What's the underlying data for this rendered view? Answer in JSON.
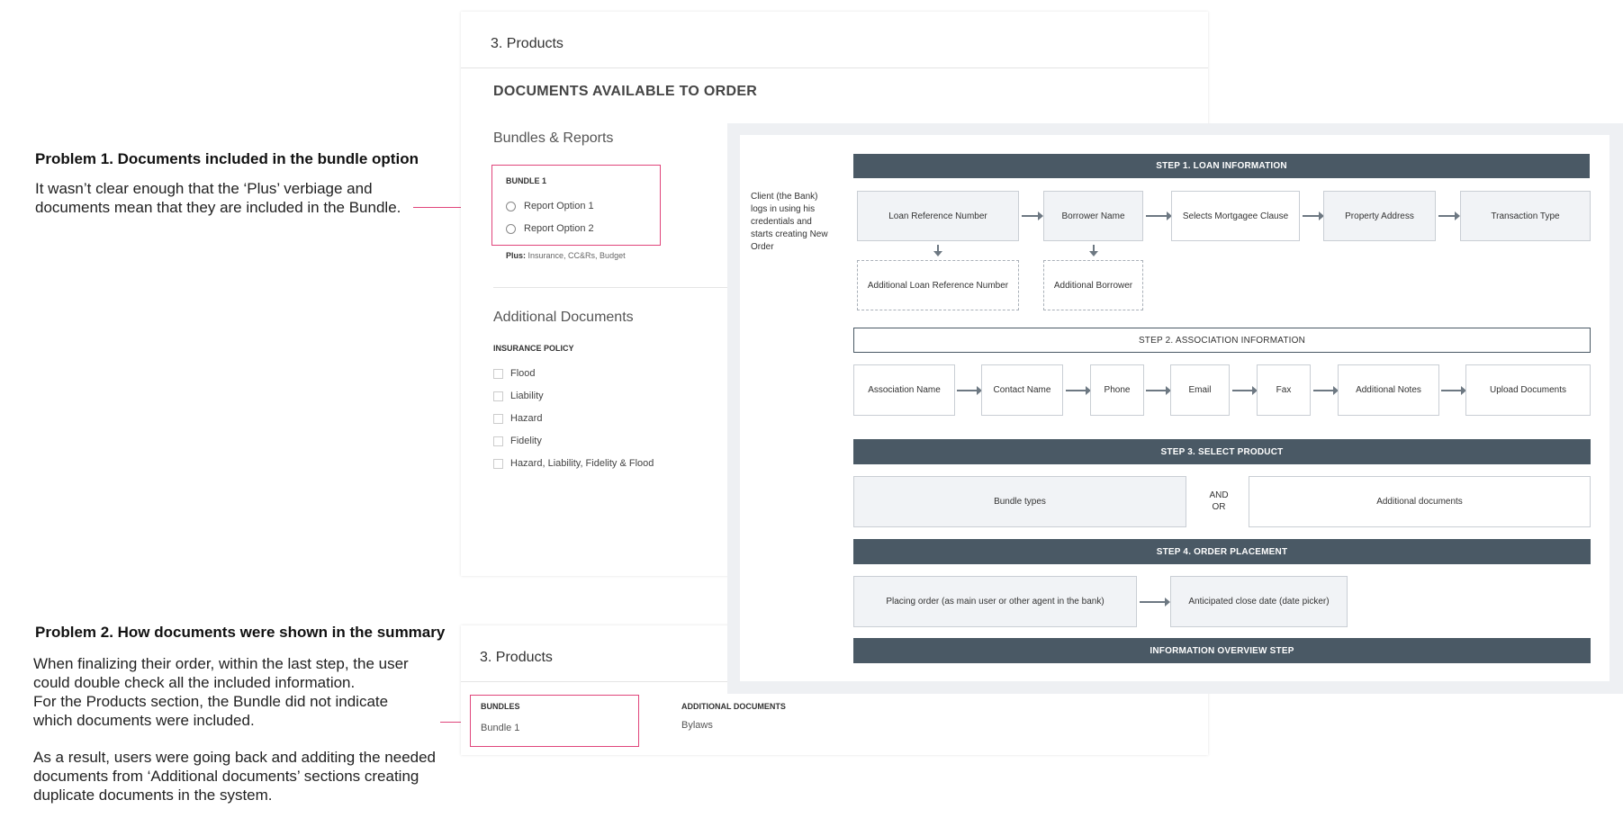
{
  "problem1": {
    "title": "Problem 1. Documents included in the bundle option",
    "line1": "It wasn’t clear enough that the ‘Plus’ verbiage and",
    "line2": "documents mean that they are included in the Bundle."
  },
  "problem2": {
    "title": "Problem 2. How documents were shown in the summary",
    "lines": [
      "When finalizing their order, within the last step, the user",
      "could double check all the included information.",
      "For the Products section, the Bundle did not indicate",
      "which documents were included.",
      "As a result, users were going back and additing the needed",
      "documents from ‘Additional documents’ sections creating",
      "duplicate documents in the system."
    ]
  },
  "products_card": {
    "title": "3. Products",
    "documents_heading": "DOCUMENTS AVAILABLE TO ORDER",
    "bundles_heading": "Bundles & Reports",
    "bundle_label": "BUNDLE 1",
    "options": [
      "Report Option 1",
      "Report Option 2"
    ],
    "plus_label": "Plus:",
    "plus_text": "Insurance, CC&Rs, Budget",
    "additional_heading": "Additional Documents",
    "insurance_label": "INSURANCE POLICY",
    "insurance_options": [
      "Flood",
      "Liability",
      "Hazard",
      "Fidelity",
      "Hazard, Liability, Fidelity & Flood"
    ]
  },
  "summary_card": {
    "title": "3. Products",
    "bundles_label": "BUNDLES",
    "bundles_value": "Bundle 1",
    "additional_label": "ADDITIONAL DOCUMENTS",
    "additional_value": "Bylaws"
  },
  "flow": {
    "client_note": [
      "Client (the Bank)",
      "logs in using his",
      "credentials and",
      "starts creating New",
      "Order"
    ],
    "step1": {
      "title": "STEP 1. LOAN INFORMATION",
      "nodes": [
        "Loan Reference Number",
        "Borrower Name",
        "Selects Mortgagee Clause",
        "Property Address",
        "Transaction Type"
      ],
      "optional": [
        "Additional Loan Reference Number",
        "Additional Borrower"
      ]
    },
    "step2": {
      "title": "STEP 2. ASSOCIATION INFORMATION",
      "nodes": [
        "Association Name",
        "Contact Name",
        "Phone",
        "Email",
        "Fax",
        "Additional Notes",
        "Upload Documents"
      ]
    },
    "step3": {
      "title": "STEP 3. SELECT PRODUCT",
      "left": "Bundle types",
      "and": "AND",
      "or": "OR",
      "right": "Additional documents"
    },
    "step4": {
      "title": "STEP 4. ORDER PLACEMENT",
      "nodes": [
        "Placing order (as main user or other agent in the bank)",
        "Anticipated close date (date picker)"
      ]
    },
    "overview": "INFORMATION OVERVIEW STEP"
  },
  "colors": {
    "accent_pink": "#e0457b",
    "step_bar": "#4a5965",
    "node_fill": "#f1f3f6"
  }
}
